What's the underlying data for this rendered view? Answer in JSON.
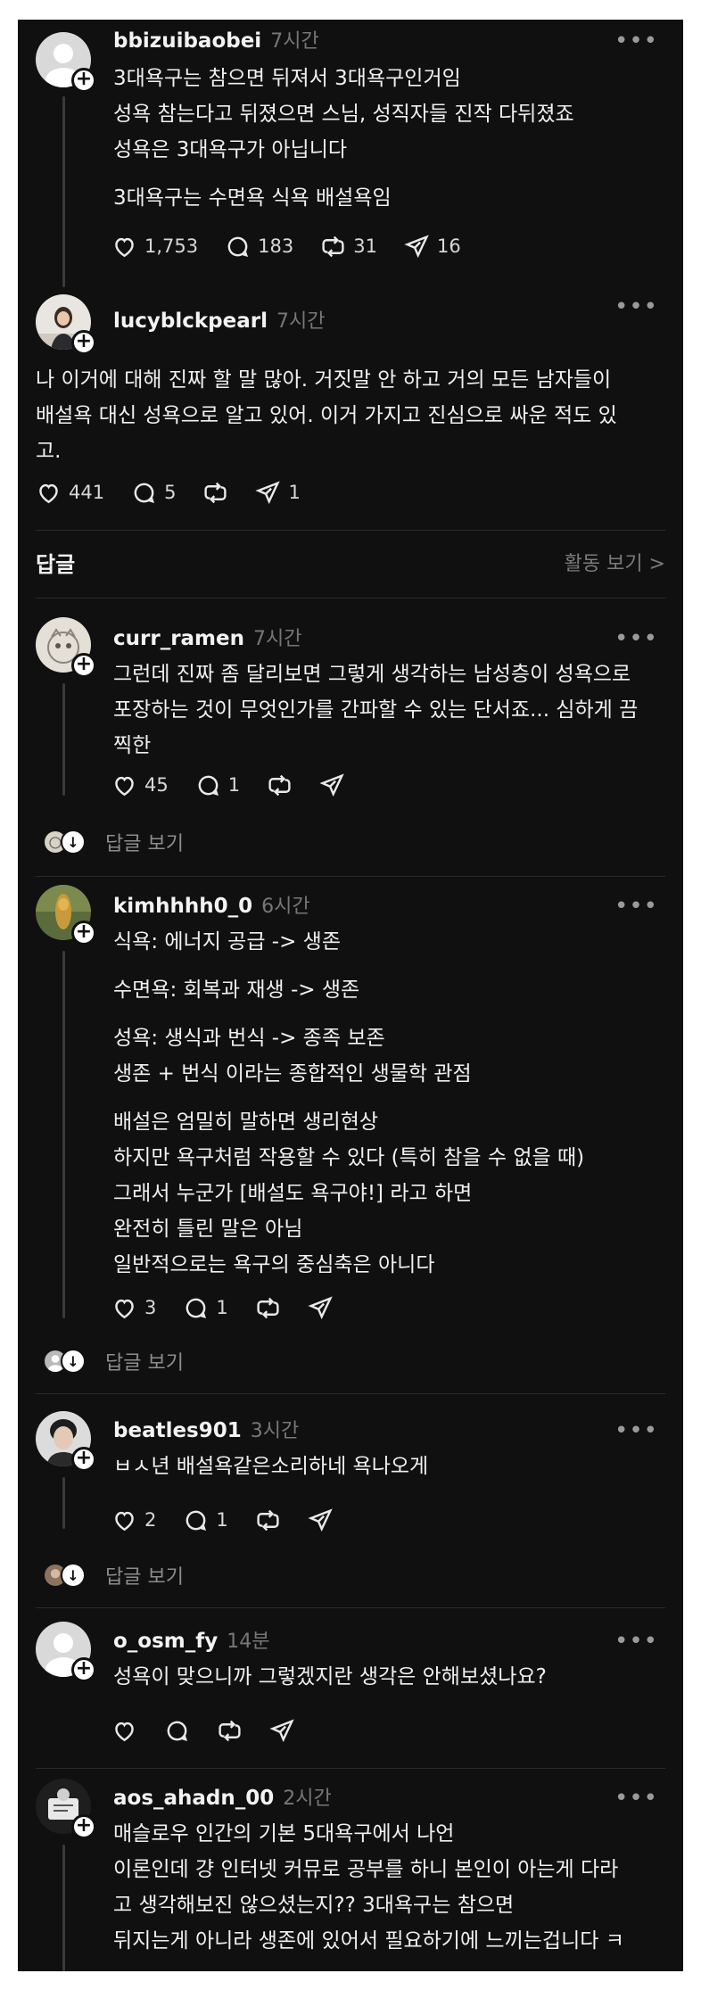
{
  "posts": [
    {
      "username": "bbizuibaobei",
      "time": "7시간",
      "lines": [
        "3대욕구는 참으면 뒤져서 3대욕구인거임",
        "성욕 참는다고 뒤졌으면 스님, 성직자들 진작 다뒤졌죠",
        "성욕은 3대욕구가 아닙니다",
        "",
        "3대욕구는 수면욕 식욕 배설욕임"
      ],
      "likes": "1,753",
      "comments": "183",
      "reposts": "31",
      "shares": "16"
    },
    {
      "username": "lucyblckpearl",
      "time": "7시간",
      "lines": [
        "나 이거에 대해 진짜 할 말 많아. 거짓말 안 하고 거의 모든 남자들이",
        "배설욕 대신 성욕으로 알고 있어. 이거 가지고 진심으로 싸운 적도 있",
        "고."
      ],
      "likes": "441",
      "comments": "5",
      "reposts": "",
      "shares": "1"
    }
  ],
  "section": {
    "title": "답글",
    "activity": "활동 보기 >"
  },
  "replies": [
    {
      "username": "curr_ramen",
      "time": "7시간",
      "lines": [
        "그런데 진짜 좀 달리보면 그렇게 생각하는 남성층이 성욕으로",
        "포장하는 것이 무엇인가를 간파할 수 있는 단서죠... 심하게 끔",
        "찍한"
      ],
      "likes": "45",
      "comments": "1",
      "view_replies": "답글 보기"
    },
    {
      "username": "kimhhhh0_0",
      "time": "6시간",
      "lines": [
        "식욕: 에너지 공급 -> 생존",
        "",
        "수면욕: 회복과 재생 -> 생존",
        "",
        "성욕: 생식과 번식 -> 종족 보존",
        "생존 + 번식 이라는 종합적인 생물학 관점",
        "",
        "배설은 엄밀히 말하면 생리현상",
        "하지만 욕구처럼 작용할 수 있다 (특히 참을 수 없을 때)",
        "그래서 누군가 [배설도 욕구야!] 라고 하면",
        "완전히 틀린 말은 아님",
        "일반적으로는 욕구의 중심축은 아니다"
      ],
      "likes": "3",
      "comments": "1",
      "view_replies": "답글 보기"
    },
    {
      "username": "beatles901",
      "time": "3시간",
      "lines": [
        "ㅂㅅ년 배설욕같은소리하네  욕나오게"
      ],
      "likes": "2",
      "comments": "1",
      "view_replies": "답글 보기"
    },
    {
      "username": "o_osm_fy",
      "time": "14분",
      "lines": [
        "성욕이 맞으니까 그렇겠지란 생각은 안해보셨나요?"
      ],
      "likes": "",
      "comments": ""
    },
    {
      "username": "aos_ahadn_00",
      "time": "2시간",
      "lines": [
        "매슬로우 인간의 기본 5대욕구에서 나언",
        "이론인데 걍 인터넷 커뮤로 공부를 하니 본인이 아는게 다라",
        "고 생각해보진 않으셨는지?? 3대욕구는 참으면",
        "뒤지는게 아니라 생존에 있어서 필요하기에 느끼는겁니다 ㅋ"
      ]
    }
  ],
  "colors": {
    "background": "#101010",
    "text": "#f3f3f3",
    "muted": "#777777",
    "divider": "#2a2a2a"
  },
  "icons": [
    "heart-icon",
    "comment-icon",
    "repost-icon",
    "share-icon",
    "more-icon",
    "plus-icon",
    "arrow-down-icon"
  ]
}
